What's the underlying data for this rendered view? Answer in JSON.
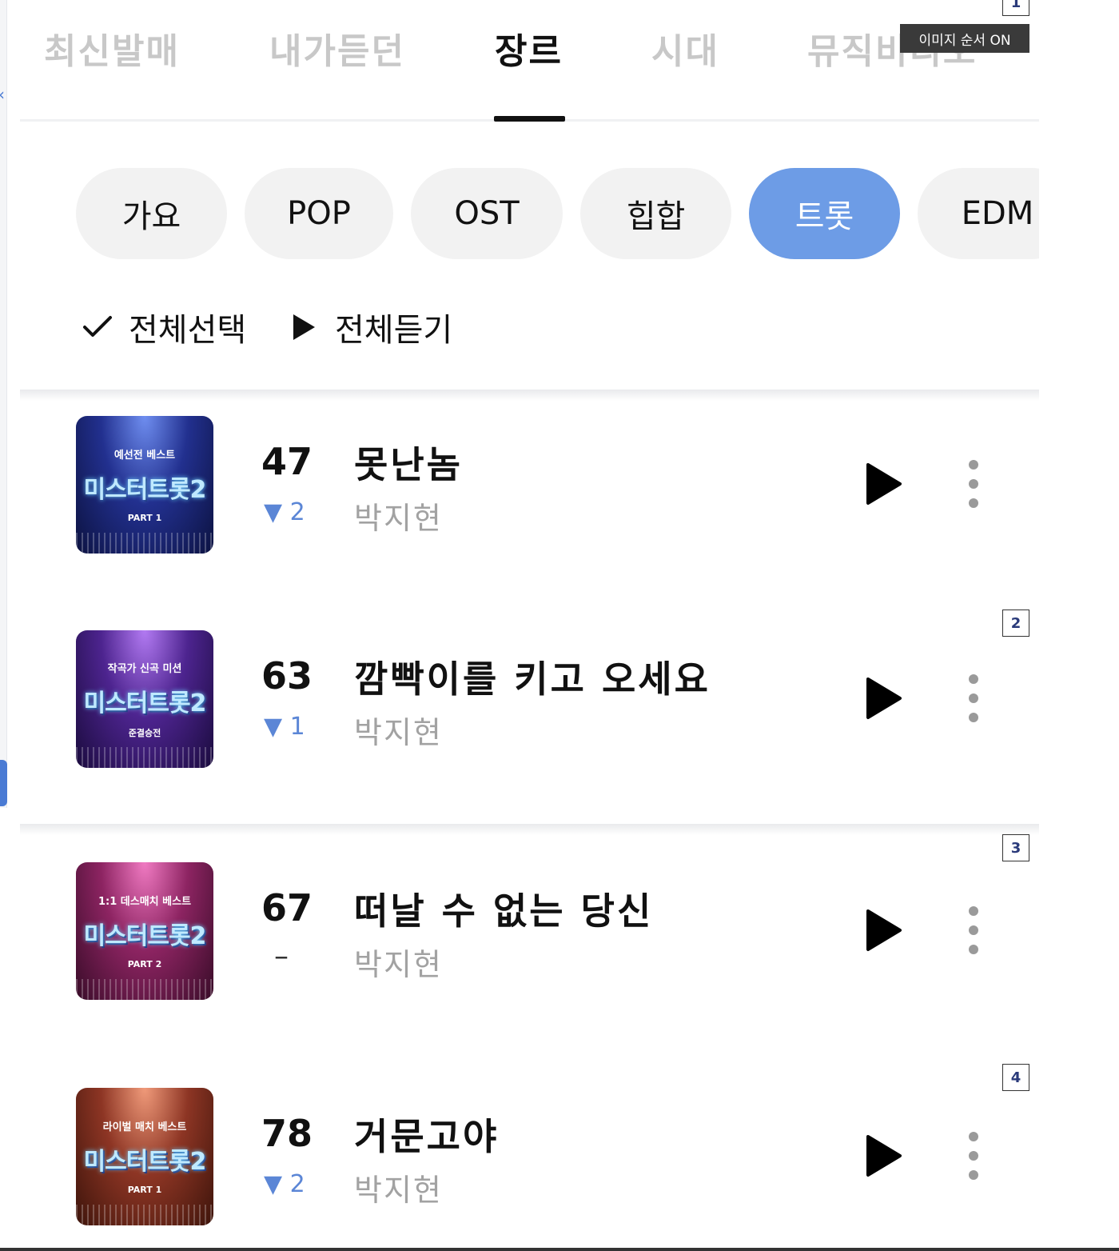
{
  "top_tabs": [
    "최신발매",
    "내가듣던",
    "장르",
    "시대",
    "뮤직비디오"
  ],
  "active_top_tab": "장르",
  "genres": [
    "가요",
    "POP",
    "OST",
    "힙합",
    "트롯",
    "EDM"
  ],
  "active_genre": "트롯",
  "actions": {
    "select_all": "전체선택",
    "play_all": "전체듣기"
  },
  "tracks": [
    {
      "cover_top": "예선전 베스트",
      "cover_logo": "미스터트롯2",
      "cover_sub": "PART 1",
      "rank": "47",
      "change": "▼ 2",
      "title": "못난놈",
      "artist": "박지현"
    },
    {
      "cover_top": "작곡가 신곡 미션",
      "cover_logo": "미스터트롯2",
      "cover_sub": "준결승전",
      "rank": "63",
      "change": "▼ 1",
      "title": "깜빡이를 키고 오세요",
      "artist": "박지현"
    },
    {
      "cover_top": "1:1 데스매치 베스트",
      "cover_logo": "미스터트롯2",
      "cover_sub": "PART 2",
      "rank": "67",
      "change": "–",
      "title": "떠날 수 없는 당신",
      "artist": "박지현"
    },
    {
      "cover_top": "라이벌 매치 베스트",
      "cover_logo": "미스터트롯2",
      "cover_sub": "PART 1",
      "rank": "78",
      "change": "▼ 2",
      "title": "거문고야",
      "artist": "박지현"
    }
  ],
  "page_markers": [
    "1",
    "2",
    "3",
    "4"
  ],
  "image_order_badge": "이미지 순서 ON",
  "colors": {
    "accent": "#6d9ce6",
    "rank_down": "#5b86d6",
    "muted": "#a2a2a2"
  },
  "icons": [
    "check-icon",
    "play-icon",
    "more-vertical-icon",
    "chevron-left-icon"
  ]
}
